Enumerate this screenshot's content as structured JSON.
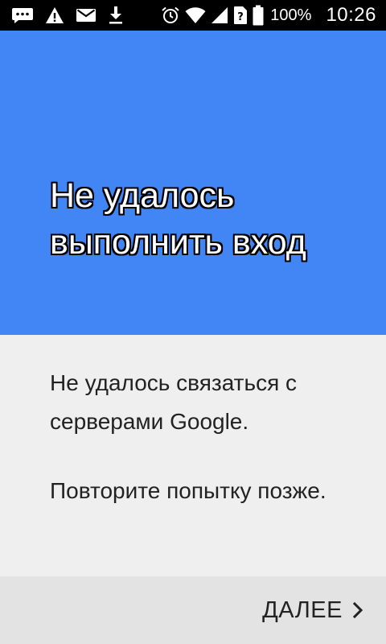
{
  "status_bar": {
    "battery_text": "100%",
    "clock": "10:26",
    "icons": [
      "chat-icon",
      "warning-icon",
      "mail-icon",
      "download-icon",
      "alarm-icon",
      "wifi-icon",
      "signal-icon",
      "sim-unknown-icon",
      "battery-icon"
    ]
  },
  "header": {
    "title": "Не удалось выполнить вход",
    "color": "#4285f4"
  },
  "content": {
    "message_1": "Не удалось связаться с серверами Google.",
    "message_2": "Повторите попытку позже."
  },
  "footer": {
    "next_label": "ДАЛЕЕ",
    "next_icon": "chevron-right-icon"
  }
}
